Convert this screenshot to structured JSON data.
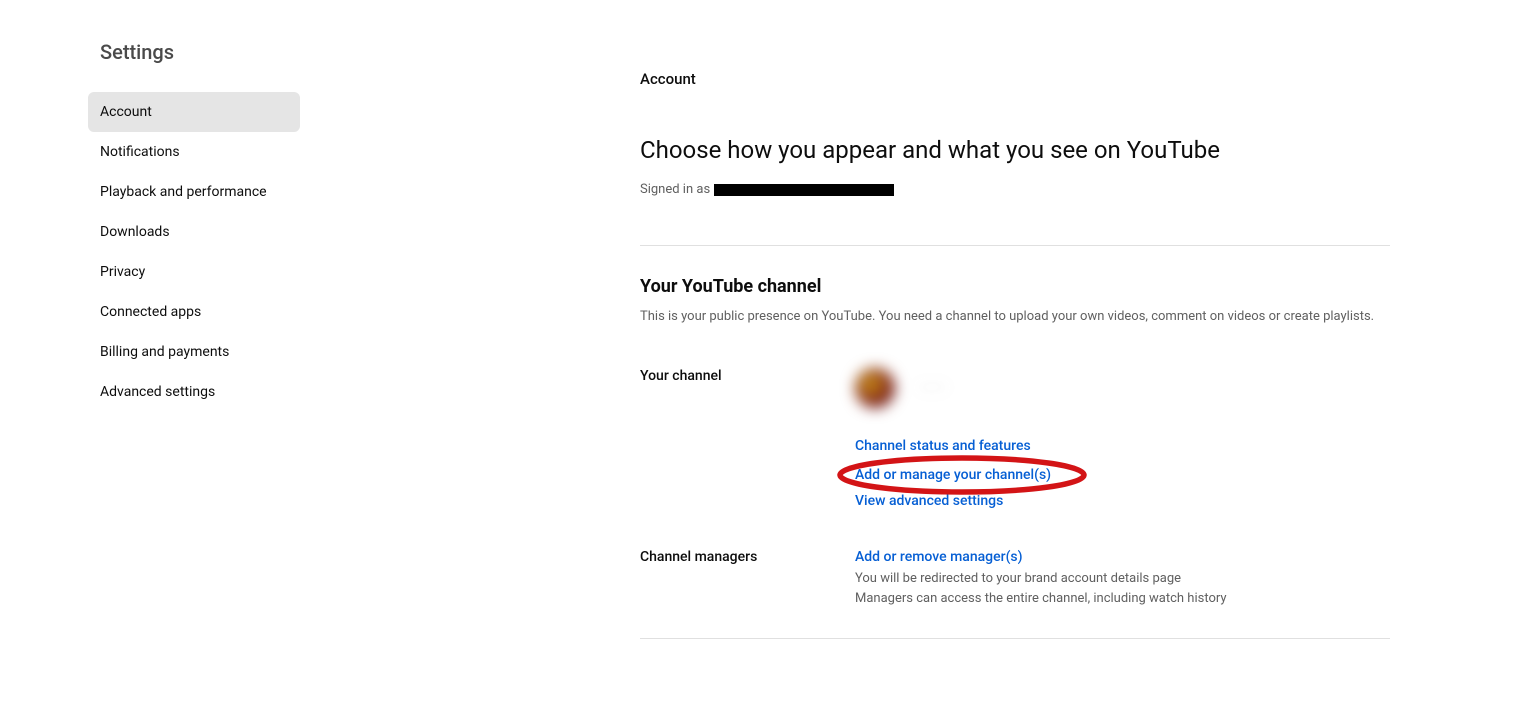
{
  "sidebar": {
    "title": "Settings",
    "items": [
      {
        "label": "Account",
        "active": true
      },
      {
        "label": "Notifications",
        "active": false
      },
      {
        "label": "Playback and performance",
        "active": false
      },
      {
        "label": "Downloads",
        "active": false
      },
      {
        "label": "Privacy",
        "active": false
      },
      {
        "label": "Connected apps",
        "active": false
      },
      {
        "label": "Billing and payments",
        "active": false
      },
      {
        "label": "Advanced settings",
        "active": false
      }
    ]
  },
  "main": {
    "heading": "Account",
    "title": "Choose how you appear and what you see on YouTube",
    "signed_in_prefix": "Signed in as",
    "section1": {
      "title": "Your YouTube channel",
      "desc": "This is your public presence on YouTube. You need a channel to upload your own videos, comment on videos or create playlists.",
      "your_channel_label": "Your channel",
      "channel_name": "·····",
      "links": {
        "status": "Channel status and features",
        "manage": "Add or manage your channel(s)",
        "advanced": "View advanced settings"
      }
    },
    "section2": {
      "label": "Channel managers",
      "link": "Add or remove manager(s)",
      "desc_line1": "You will be redirected to your brand account details page",
      "desc_line2": "Managers can access the entire channel, including watch history"
    }
  }
}
